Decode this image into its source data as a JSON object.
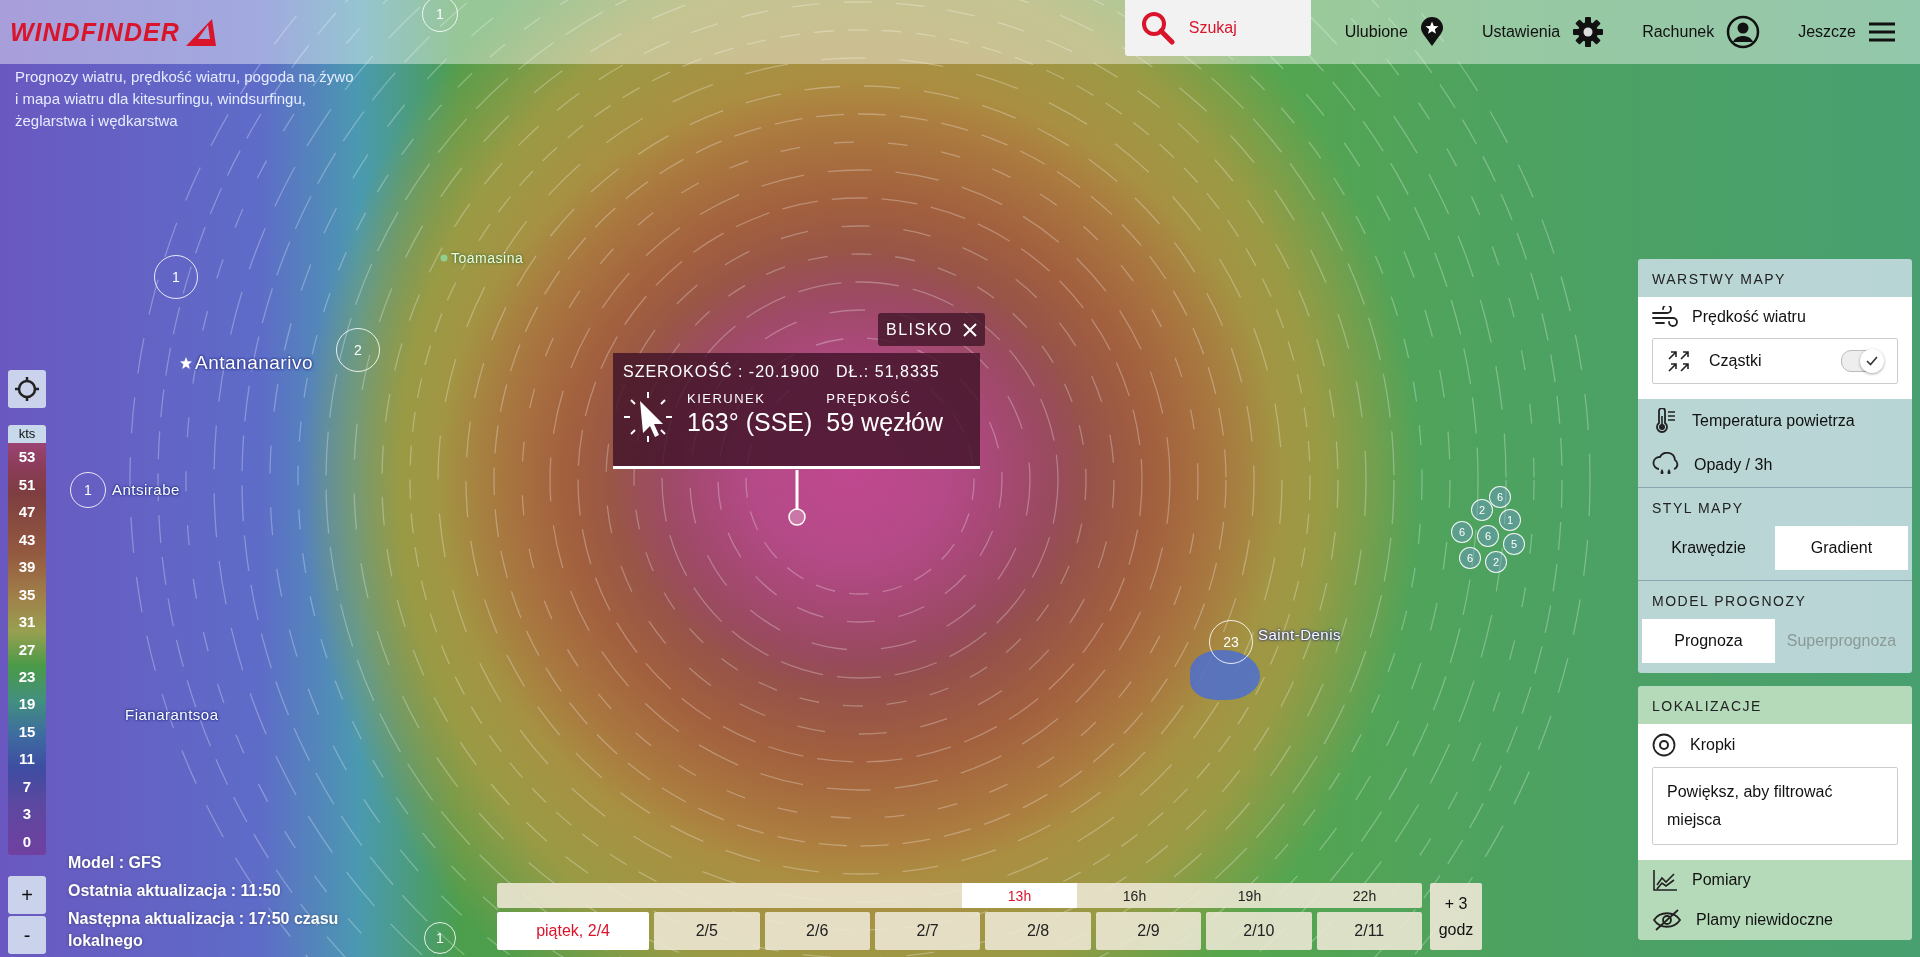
{
  "header": {
    "logo": "WINDFINDER",
    "search": "Szukaj",
    "nav": [
      {
        "label": "Ulubione"
      },
      {
        "label": "Ustawienia"
      },
      {
        "label": "Rachunek"
      },
      {
        "label": "Jeszcze"
      }
    ]
  },
  "tagline": "Prognozy wiatru, prędkość wiatru, pogoda na żywo i mapa wiatru dla kitesurfingu, windsurfingu, żeglarstwa i wędkarstwa",
  "map": {
    "places": [
      "Toamasina",
      "Antananarivo",
      "Antsirabe",
      "Fianarantsoa",
      "Saint-Denis"
    ],
    "clusters": [
      "1",
      "1",
      "2",
      "1",
      "1",
      "23"
    ],
    "spot_group": [
      "6",
      "2",
      "6",
      "6",
      "1",
      "5",
      "6",
      "2"
    ]
  },
  "legend": {
    "unit": "kts",
    "values": [
      "53",
      "51",
      "47",
      "43",
      "39",
      "35",
      "31",
      "27",
      "23",
      "19",
      "15",
      "11",
      "7",
      "3",
      "0"
    ]
  },
  "zoom": [
    "+",
    "-"
  ],
  "model_info": [
    "Model : GFS",
    "Ostatnia aktualizacja : 11:50",
    "Następna aktualizacja : 17:50 czasu lokalnego"
  ],
  "popup": {
    "close": "BLISKO",
    "latitude": "SZEROKOŚĆ : -20.1900",
    "longitude": "DŁ.: 51,8335",
    "direction_label": "KIERUNEK",
    "direction": "163° (SSE)",
    "speed_label": "PRĘDKOŚĆ",
    "speed": "59 węzłów"
  },
  "panel": {
    "layers": {
      "title": "WARSTWY MAPY",
      "items": [
        {
          "label": "Prędkość wiatru",
          "selected": true,
          "toggle": {
            "label": "Cząstki",
            "on": true
          }
        },
        {
          "label": "Temperatura powietrza",
          "selected": false
        },
        {
          "label": "Opady / 3h",
          "selected": false
        }
      ]
    },
    "style": {
      "title": "STYL MAPY",
      "options": [
        {
          "label": "Krawędzie",
          "selected": false
        },
        {
          "label": "Gradient",
          "selected": true
        }
      ]
    },
    "model": {
      "title": "MODEL PROGNOZY",
      "options": [
        {
          "label": "Prognoza",
          "selected": true,
          "disabled": false
        },
        {
          "label": "Superprognoza",
          "selected": false,
          "disabled": true
        }
      ]
    },
    "locations": {
      "title": "LOKALIZACJE",
      "items": [
        {
          "label": "Kropki",
          "selected": true,
          "note": "Powiększ, aby filtrować miejsca"
        },
        {
          "label": "Pomiary",
          "selected": false
        },
        {
          "label": "Plamy niewidoczne",
          "selected": false
        }
      ]
    }
  },
  "timeline": {
    "hours": [
      {
        "label": "13h",
        "selected": true
      },
      {
        "label": "16h",
        "selected": false
      },
      {
        "label": "19h",
        "selected": false
      },
      {
        "label": "22h",
        "selected": false
      }
    ],
    "days": [
      {
        "label": "piątek, 2/4",
        "selected": true
      },
      {
        "label": "2/5",
        "selected": false
      },
      {
        "label": "2/6",
        "selected": false
      },
      {
        "label": "2/7",
        "selected": false
      },
      {
        "label": "2/8",
        "selected": false
      },
      {
        "label": "2/9",
        "selected": false
      },
      {
        "label": "2/10",
        "selected": false
      },
      {
        "label": "2/11",
        "selected": false
      }
    ],
    "more": "+ 3 godz"
  }
}
